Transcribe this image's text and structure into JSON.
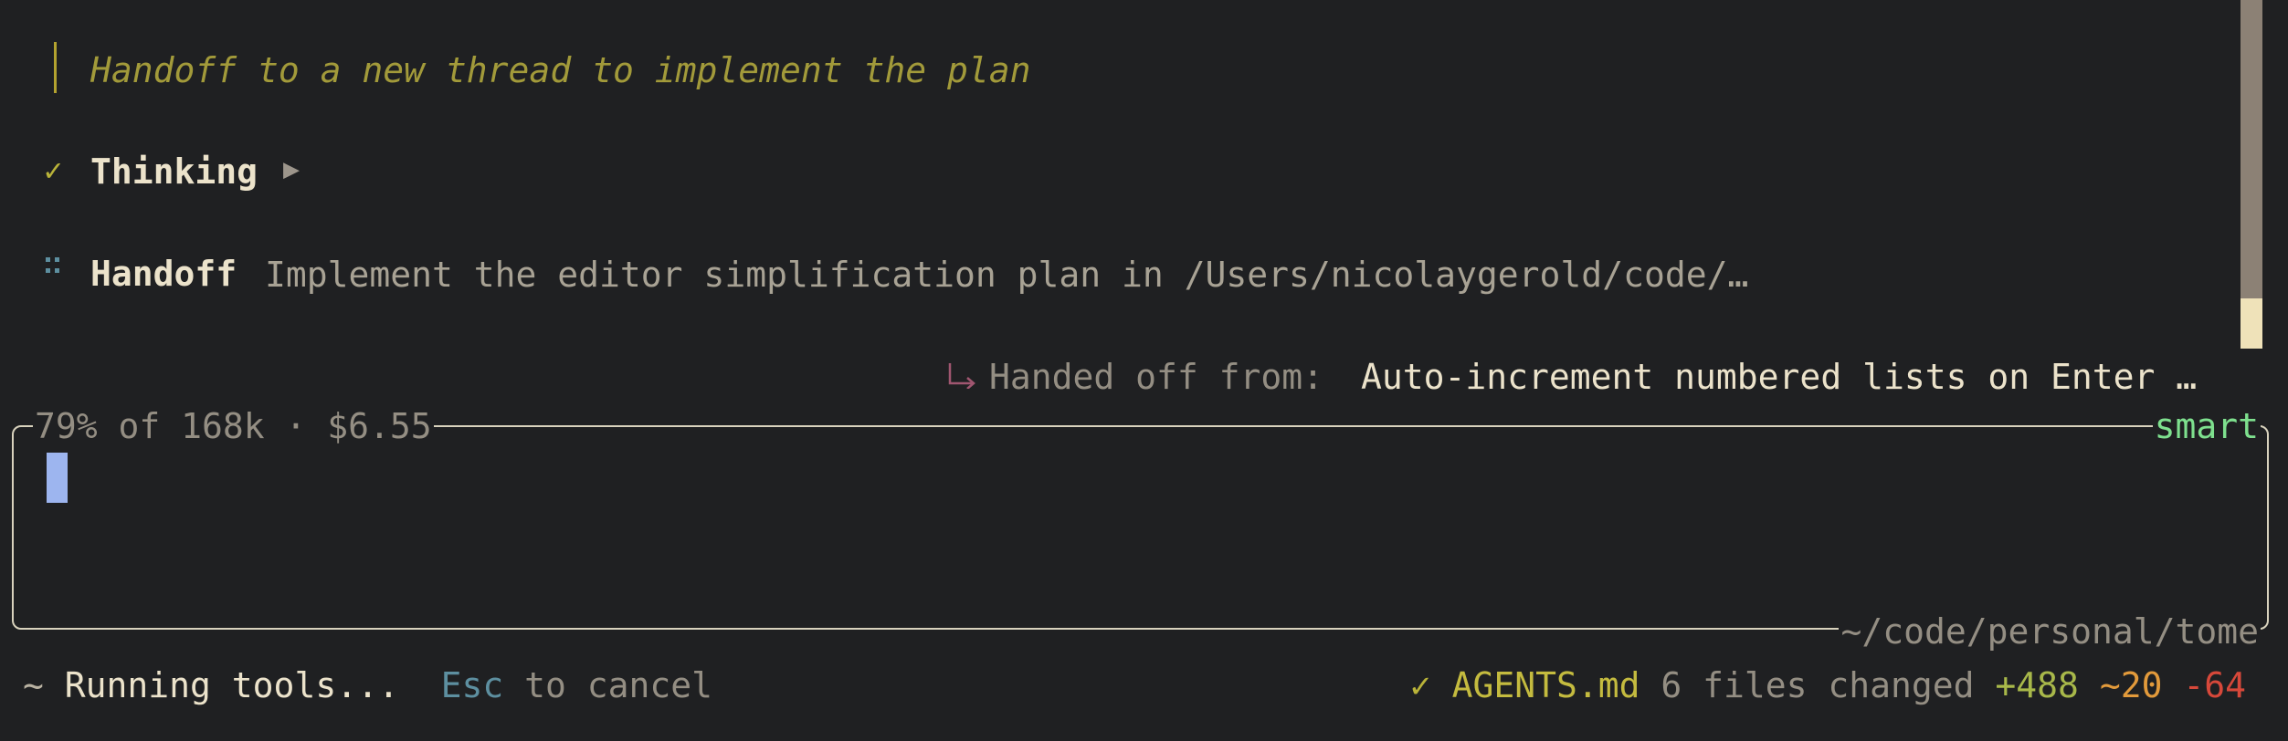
{
  "transcript": {
    "quote": "Handoff to a new thread to implement the plan",
    "thinking": {
      "label": "Thinking",
      "expand_icon": "play-triangle-icon",
      "status_icon": "check-icon"
    },
    "handoff": {
      "label": "Handoff",
      "text": "Implement the editor simplification plan in /Users/nicolaygerold/code/…",
      "status_icon": "dots-spinner-icon"
    },
    "handed_off": {
      "label": "Handed off from: ",
      "value": "Auto-increment numbered lists on Enter …",
      "icon": "corner-arrow-icon"
    }
  },
  "input_box": {
    "usage": "79% of 168k · $6.55",
    "mode": "smart",
    "path": "~/code/personal/tome",
    "value": ""
  },
  "status_bar": {
    "spinner": "~",
    "activity": "Running tools...",
    "cancel_key": "Esc",
    "cancel_text": " to cancel",
    "check": "✓",
    "file": "AGENTS.md",
    "changed": "6 files changed",
    "added": "+488",
    "modified": "~20",
    "removed": "-64"
  },
  "colors": {
    "background": "#1f2022",
    "accent_yellow": "#b9b339",
    "accent_green": "#7ee08e",
    "cursor": "#9db5ef",
    "removed": "#d7483a",
    "modified": "#e29a3b"
  }
}
